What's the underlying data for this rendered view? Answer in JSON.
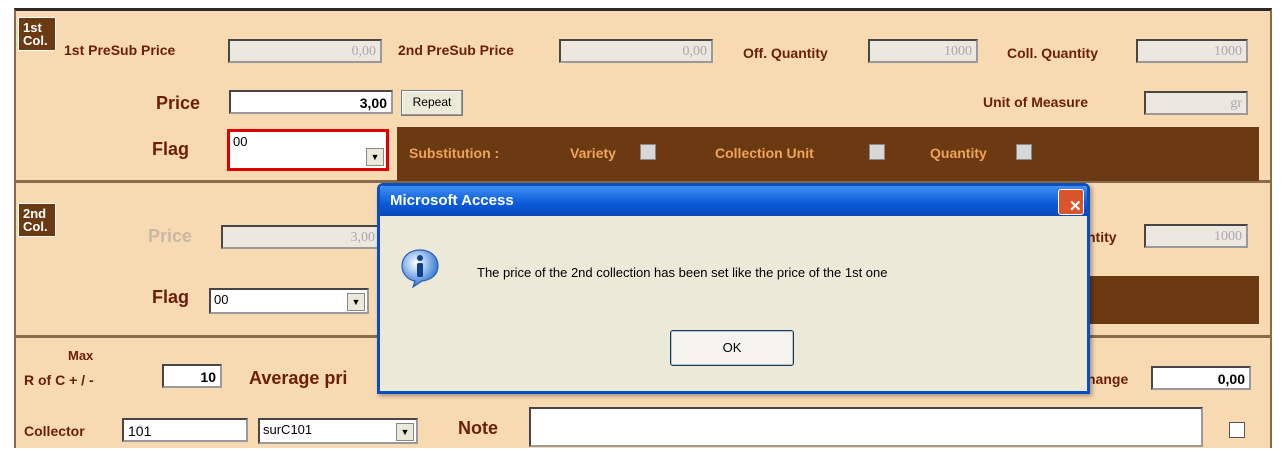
{
  "section1": {
    "badge": "1st Col.",
    "presub1_label": "1st PreSub Price",
    "presub1_value": "0,00",
    "presub2_label": "2nd PreSub Price",
    "presub2_value": "0,00",
    "off_qty_label": "Off. Quantity",
    "off_qty_value": "1000",
    "coll_qty_label": "Coll. Quantity",
    "coll_qty_value": "1000",
    "price_label": "Price",
    "price_value": "3,00",
    "repeat_label": "Repeat",
    "uom_label": "Unit of Measure",
    "uom_value": "gr",
    "flag_label": "Flag",
    "flag_value": "00",
    "substitution_label": "Substitution :",
    "variety_label": "Variety",
    "collection_unit_label": "Collection Unit",
    "quantity_label": "Quantity"
  },
  "section2": {
    "badge": "2nd Col.",
    "price_label": "Price",
    "price_value": "3,00",
    "qty_label_partial": "ntity",
    "qty_value": "1000",
    "flag_label": "Flag",
    "flag_value": "00"
  },
  "section3": {
    "max_label": "Max",
    "rofc_label": "R of C + / -",
    "rofc_value": "10",
    "avg_label_partial": "Average pri",
    "change_label_partial": "hange",
    "change_value": "0,00",
    "collector_label": "Collector",
    "collector_value": "101",
    "collector_code": "surC101",
    "note_label": "Note",
    "note_value": ""
  },
  "dialog": {
    "title": "Microsoft Access",
    "message": "The price of the 2nd collection has been set like the price of the 1st one",
    "ok_label": "OK",
    "close_symbol": "✕"
  },
  "colors": {
    "background": "#f7d9b2",
    "label": "#6b1e0a",
    "badge": "#6b3a12",
    "substitution_text": "#f0a25a",
    "dialog_title": "#0a5ad9"
  }
}
